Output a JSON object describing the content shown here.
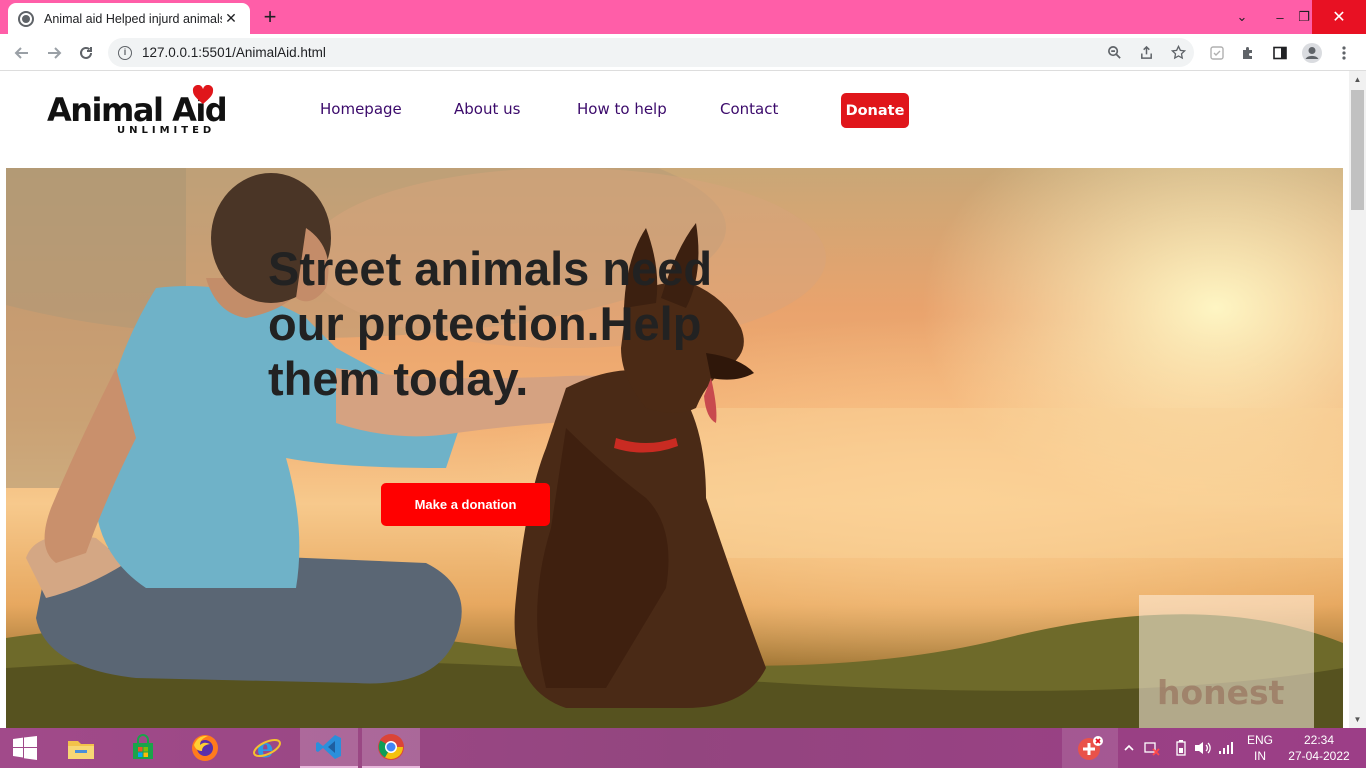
{
  "browser": {
    "tab_title": "Animal aid Helped injurd animals",
    "tab_close": "✕",
    "new_tab": "+",
    "url": "127.0.0.1:5501/AnimalAid.html",
    "window_controls": {
      "chevron": "⌄",
      "minimize": "–",
      "restore": "❐",
      "close": "✕"
    }
  },
  "site": {
    "logo": {
      "main": "Animal Aid",
      "sub": "UNLIMITED",
      "heart_color": "#e0161b"
    },
    "nav": [
      {
        "label": "Homepage"
      },
      {
        "label": "About us"
      },
      {
        "label": "How to help"
      },
      {
        "label": "Contact"
      }
    ],
    "donate_label": "Donate",
    "hero": {
      "heading": "Street animals need our protection.Help them today.",
      "cta_label": "Make a donation",
      "watermark": "honest"
    }
  },
  "taskbar": {
    "apps": [
      "windows-start",
      "file-explorer",
      "microsoft-store",
      "firefox",
      "internet-explorer",
      "vs-code",
      "chrome"
    ],
    "language": {
      "line1": "ENG",
      "line2": "IN"
    },
    "clock": {
      "time": "22:34",
      "date": "27-04-2022"
    }
  },
  "colors": {
    "tabbar": "#ff5ea8",
    "nav_link": "#3b0a6b",
    "donate": "#e0161b",
    "cta": "#ff0000",
    "taskbar": "#a14a8a"
  }
}
